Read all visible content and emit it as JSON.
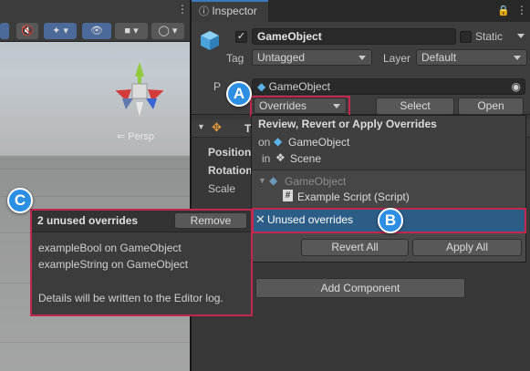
{
  "inspector": {
    "tab_label": "Inspector",
    "object_name": "GameObject",
    "static_label": "Static",
    "tag_label": "Tag",
    "tag_value": "Untagged",
    "layer_label": "Layer",
    "layer_value": "Default",
    "prefab_label": "P",
    "prefab_value": "GameObject",
    "overrides_label": "Overrides",
    "select_label": "Select",
    "open_label": "Open",
    "transform_title": "T",
    "position_label": "Position",
    "rotation_label": "Rotation",
    "scale_label": "Scale",
    "add_component_label": "Add Component"
  },
  "scene": {
    "persp_label": "Persp"
  },
  "popup": {
    "title": "Review, Revert or Apply Overrides",
    "on_prefix": "on",
    "on_object": "GameObject",
    "in_prefix": "in",
    "in_scene": "Scene",
    "tree_root": "GameObject",
    "tree_child": "Example Script (Script)",
    "unused_label": "Unused overrides",
    "revert_all": "Revert All",
    "apply_all": "Apply All"
  },
  "tooltip": {
    "title": "2 unused overrides",
    "remove_label": "Remove",
    "line1": "exampleBool on GameObject",
    "line2": "exampleString on GameObject",
    "note": "Details will be written to the Editor log."
  },
  "callouts": {
    "a": "A",
    "b": "B",
    "c": "C"
  },
  "colors": {
    "highlight": "#c2274e",
    "callout": "#2d8fe3",
    "selection": "#2c5d87"
  }
}
